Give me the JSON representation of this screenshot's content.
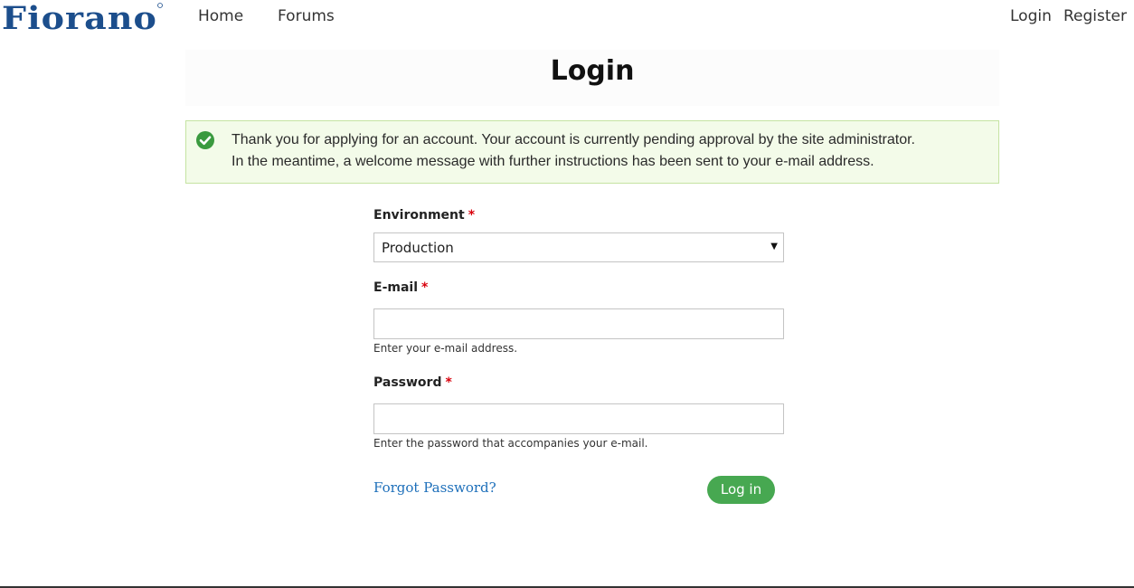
{
  "header": {
    "logo_text": "Fiorano",
    "nav": [
      {
        "label": "Home"
      },
      {
        "label": "Forums"
      }
    ],
    "user_links": [
      {
        "label": "Login"
      },
      {
        "label": "Register"
      }
    ]
  },
  "page": {
    "title": "Login"
  },
  "status_message": {
    "icon": "checkmark-circle-icon",
    "line1": "Thank you for applying for an account. Your account is currently pending approval by the site administrator.",
    "line2": "In the meantime, a welcome message with further instructions has been sent to your e-mail address."
  },
  "form": {
    "environment": {
      "label": "Environment",
      "required_mark": "*",
      "selected": "Production"
    },
    "email": {
      "label": "E-mail",
      "required_mark": "*",
      "value": "",
      "help": "Enter your e-mail address."
    },
    "password": {
      "label": "Password",
      "required_mark": "*",
      "value": "",
      "help": "Enter the password that accompanies your e-mail."
    },
    "forgot_link": "Forgot Password?",
    "submit_label": "Log in"
  },
  "colors": {
    "brand_blue": "#1c4e8c",
    "success_green": "#47a851",
    "link_blue": "#1d6fba",
    "required_red": "#d8000c"
  }
}
